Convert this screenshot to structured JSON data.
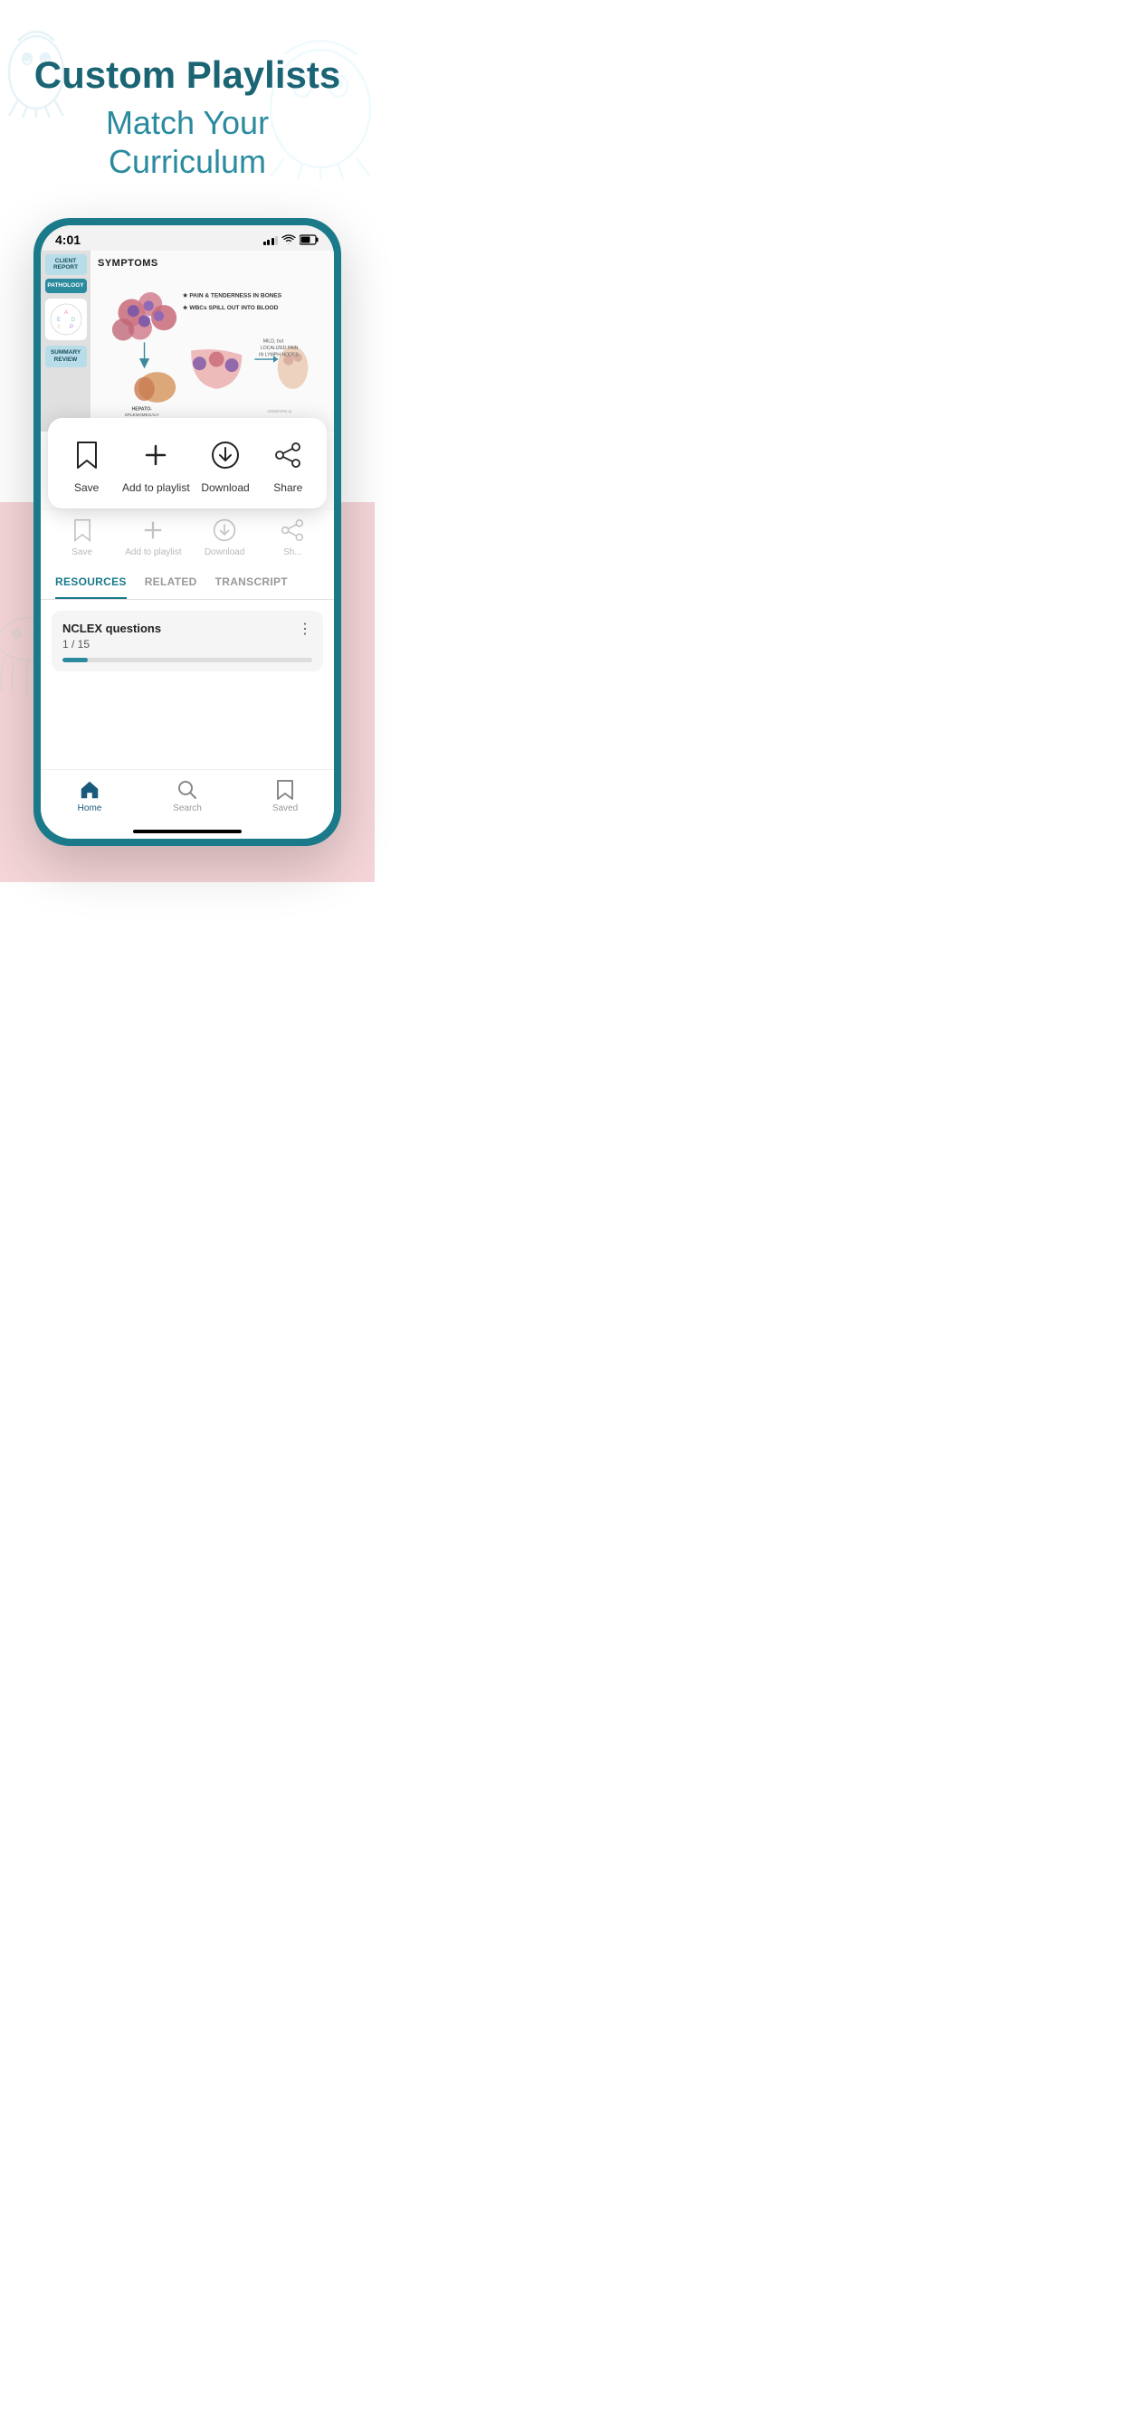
{
  "page": {
    "title": "Custom Playlists",
    "subtitle": "Match Your Curriculum"
  },
  "status_bar": {
    "time": "4:01",
    "signal": "signal",
    "wifi": "wifi",
    "battery": "battery"
  },
  "video": {
    "section_title": "SYMPTOMS",
    "sidebar_items": [
      "CLIENT REPORT",
      "PATHOLOGY",
      "SUMMARY REVIEW"
    ],
    "bullet1": "PAIN & TENDERNESS IN BONES",
    "bullet2": "WBCs SPILL OUT INTO BLOOD"
  },
  "action_popup": {
    "save_label": "Save",
    "add_playlist_label": "Add to playlist",
    "download_label": "Download",
    "share_label": "Share"
  },
  "action_bar_ghost": {
    "save_label": "Save",
    "add_playlist_label": "Add to playlist",
    "download_label": "Download",
    "share_label": "Sh..."
  },
  "tabs": {
    "resources": "RESOURCES",
    "related": "RELATED",
    "transcript": "TRANSCRIPT",
    "active": "resources"
  },
  "resource_card": {
    "title": "NCLEX questions",
    "progress_text": "1 / 15",
    "progress_percent": 10
  },
  "bottom_nav": {
    "home_label": "Home",
    "search_label": "Search",
    "saved_label": "Saved"
  },
  "colors": {
    "teal_dark": "#1a6474",
    "teal_medium": "#1a7a8a",
    "teal_light": "#2a8a9e",
    "pink_bg": "#f5d5d8",
    "accent_blue": "#4a9fb5"
  }
}
